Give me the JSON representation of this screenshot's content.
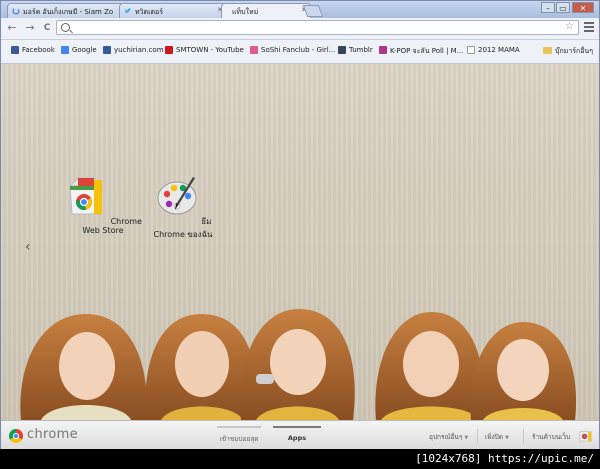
{
  "tabs": [
    {
      "title": "มอร์ค อันเก็งเกษมี - Siam Zo",
      "icon": "loading-icon",
      "active": false
    },
    {
      "title": "ทวิตเตอร์",
      "icon": "twitter-icon",
      "active": false
    },
    {
      "title": "แท็บใหม่",
      "icon": "",
      "active": true
    }
  ],
  "window_controls": {
    "minimize": "–",
    "maximize": "▭",
    "close": "✕"
  },
  "toolbar": {
    "back": "←",
    "forward": "→",
    "reload": "C",
    "address_value": "",
    "address_placeholder": ""
  },
  "bookmarks": [
    {
      "label": "Facebook",
      "icon": "facebook-icon",
      "color": "#3b5998"
    },
    {
      "label": "Google",
      "icon": "google-icon",
      "color": "#4285f4"
    },
    {
      "label": "yuchirian.com",
      "icon": "facebook-icon",
      "color": "#3b5998"
    },
    {
      "label": "SMTOWN - YouTube",
      "icon": "youtube-icon",
      "color": "#cc181e"
    },
    {
      "label": "SoShi Fanclub - Girl...",
      "icon": "soshi-icon",
      "color": "#e05a8c"
    },
    {
      "label": "Tumblr",
      "icon": "tumblr-icon",
      "color": "#35465c"
    },
    {
      "label": "K-POP จะลัน Poll | M...",
      "icon": "kpop-icon",
      "color": "#b0358c"
    },
    {
      "label": "2012 MAMA",
      "icon": "page-icon",
      "color": "#ffffff"
    }
  ],
  "other_bookmarks": "บุ๊กมาร์กอื่นๆ",
  "apps": [
    {
      "label": "Chrome Web Store",
      "icon": "chrome-web-store-icon"
    },
    {
      "label": "ธีม Chrome ของฉัน",
      "icon": "palette-icon"
    }
  ],
  "footer": {
    "brand": "chrome",
    "tabs": [
      {
        "label": "เข้าชมบ่อยสุด",
        "active": false
      },
      {
        "label": "Apps",
        "active": true
      }
    ],
    "devices": "อุปกรณ์อื่นๆ",
    "recently_closed": "เพิ่งปิด",
    "web_store": "ร้านค้าบนเว็บ"
  },
  "watermark": "[1024x768] https://upic.me/",
  "colors": {
    "tab_bar": "#b9c9e6",
    "content_bg": "#d6cebf",
    "footer_bg": "#e8e8e8"
  }
}
